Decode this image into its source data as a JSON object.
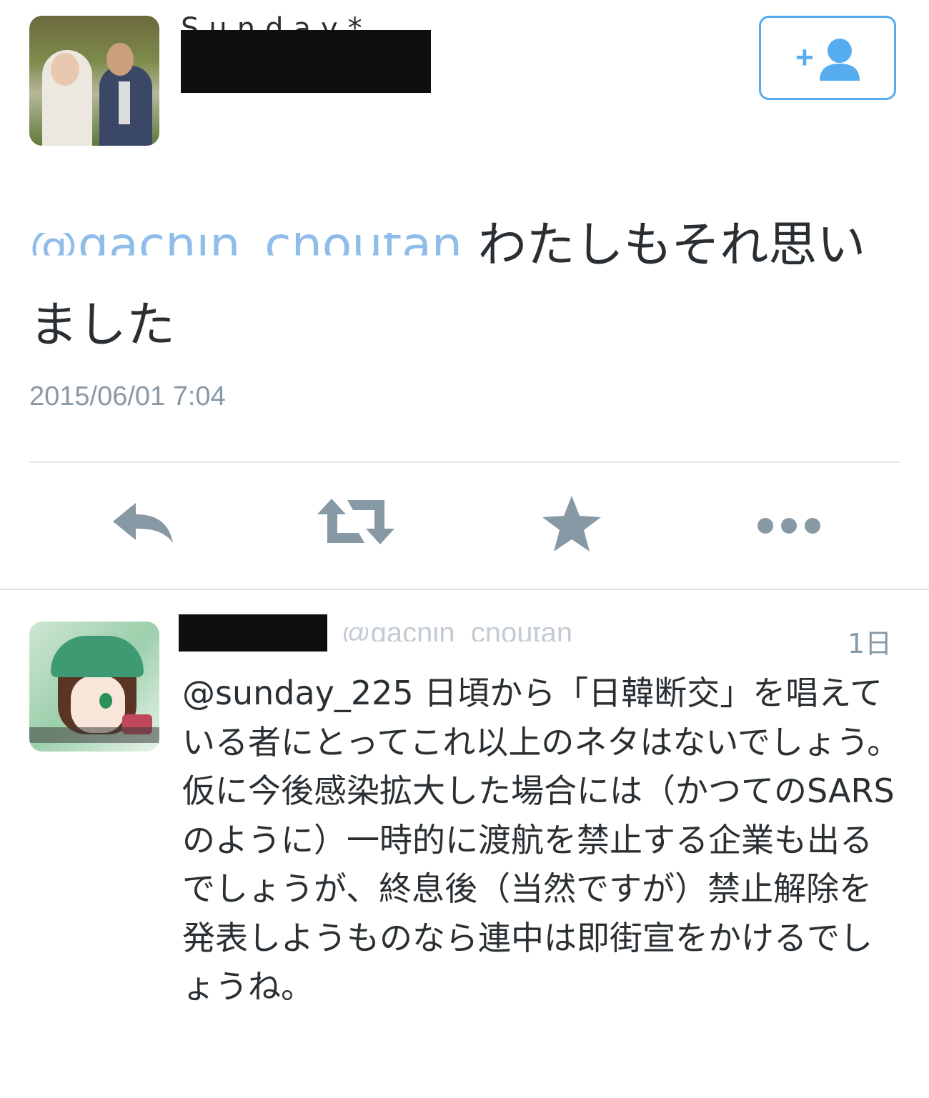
{
  "main_tweet": {
    "display_name": "Sunday*",
    "mention": "@gachin_choutan",
    "text": "わたしもそれ思いました",
    "timestamp": "2015/06/01 7:04",
    "follow_button_label": "+"
  },
  "actions": {
    "reply_icon": "reply-icon",
    "retweet_icon": "retweet-icon",
    "favorite_icon": "star-icon",
    "more_icon": "more-dots-icon"
  },
  "reply_tweet": {
    "handle": "@gachin_choutan",
    "time": "1日",
    "mention": "@sunday_225",
    "text": " 日頃から「日韓断交」を唱えている者にとってこれ以上のネタはないでしょう。仮に今後感染拡大した場合には（かつてのSARSのように）一時的に渡航を禁止する企業も出るでしょうが、終息後（当然ですが）禁止解除を発表しようものなら連中は即街宣をかけるでしょうね。"
  },
  "colors": {
    "link": "#55acee",
    "text": "#292f33",
    "muted": "#8899a6",
    "icon": "#8899a6",
    "divider": "#e1e8ed"
  }
}
